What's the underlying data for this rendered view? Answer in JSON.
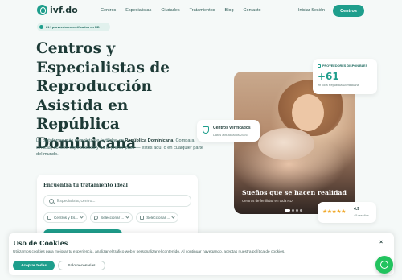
{
  "nav": {
    "logo_text": "ivf.do",
    "links": [
      "Centros",
      "Especialistas",
      "Ciudades",
      "Tratamientos",
      "Blog",
      "Contacto"
    ],
    "login": "Iniciar Sesión",
    "cta": "Centros"
  },
  "badge": {
    "text": "81+ proveedores verificados en RD"
  },
  "hero": {
    "title": "Centros y Especialistas de Reproducción Asistida en República Dominicana",
    "desc_prefix": "La plataforma más completa de fertilidad en ",
    "desc_bold": "República Dominicana",
    "desc_suffix": ". Compara clínicas, conoce especialistas y da el primer paso — estés aquí o en cualquier parte del mundo."
  },
  "search": {
    "title": "Encuentra tu tratamiento ideal",
    "placeholder": "Especialista, centro...",
    "selects": [
      "Centros y Es...",
      "Seleccionar ...",
      "Seleccionar ..."
    ]
  },
  "providers_card": {
    "label": "PROVEEDORES DISPONIBLES",
    "number": "+61",
    "sub": "en toda República Dominicana"
  },
  "verified_card": {
    "title": "Centros verificados",
    "sub": "Datos actualizados 2026"
  },
  "photo": {
    "title": "Sueños que se hacen realidad",
    "sub": "Centros de fertilidad en toda RD"
  },
  "rating_card": {
    "stars": "★★★★★",
    "rating": "4.9",
    "reviews": "+5 reseñas"
  },
  "cookie": {
    "title": "Uso de Cookies",
    "text": "Utilizamos cookies para mejorar tu experiencia, analizar el tráfico web y personalizar el contenido. Al continuar navegando, aceptas nuestra política de cookies.",
    "accept": "Aceptar todas",
    "necessary": "Solo necesarias",
    "close": "×"
  },
  "colors": {
    "accent": "#1e9e8c",
    "dark": "#1d3a36",
    "background": "#f5f9f8"
  }
}
